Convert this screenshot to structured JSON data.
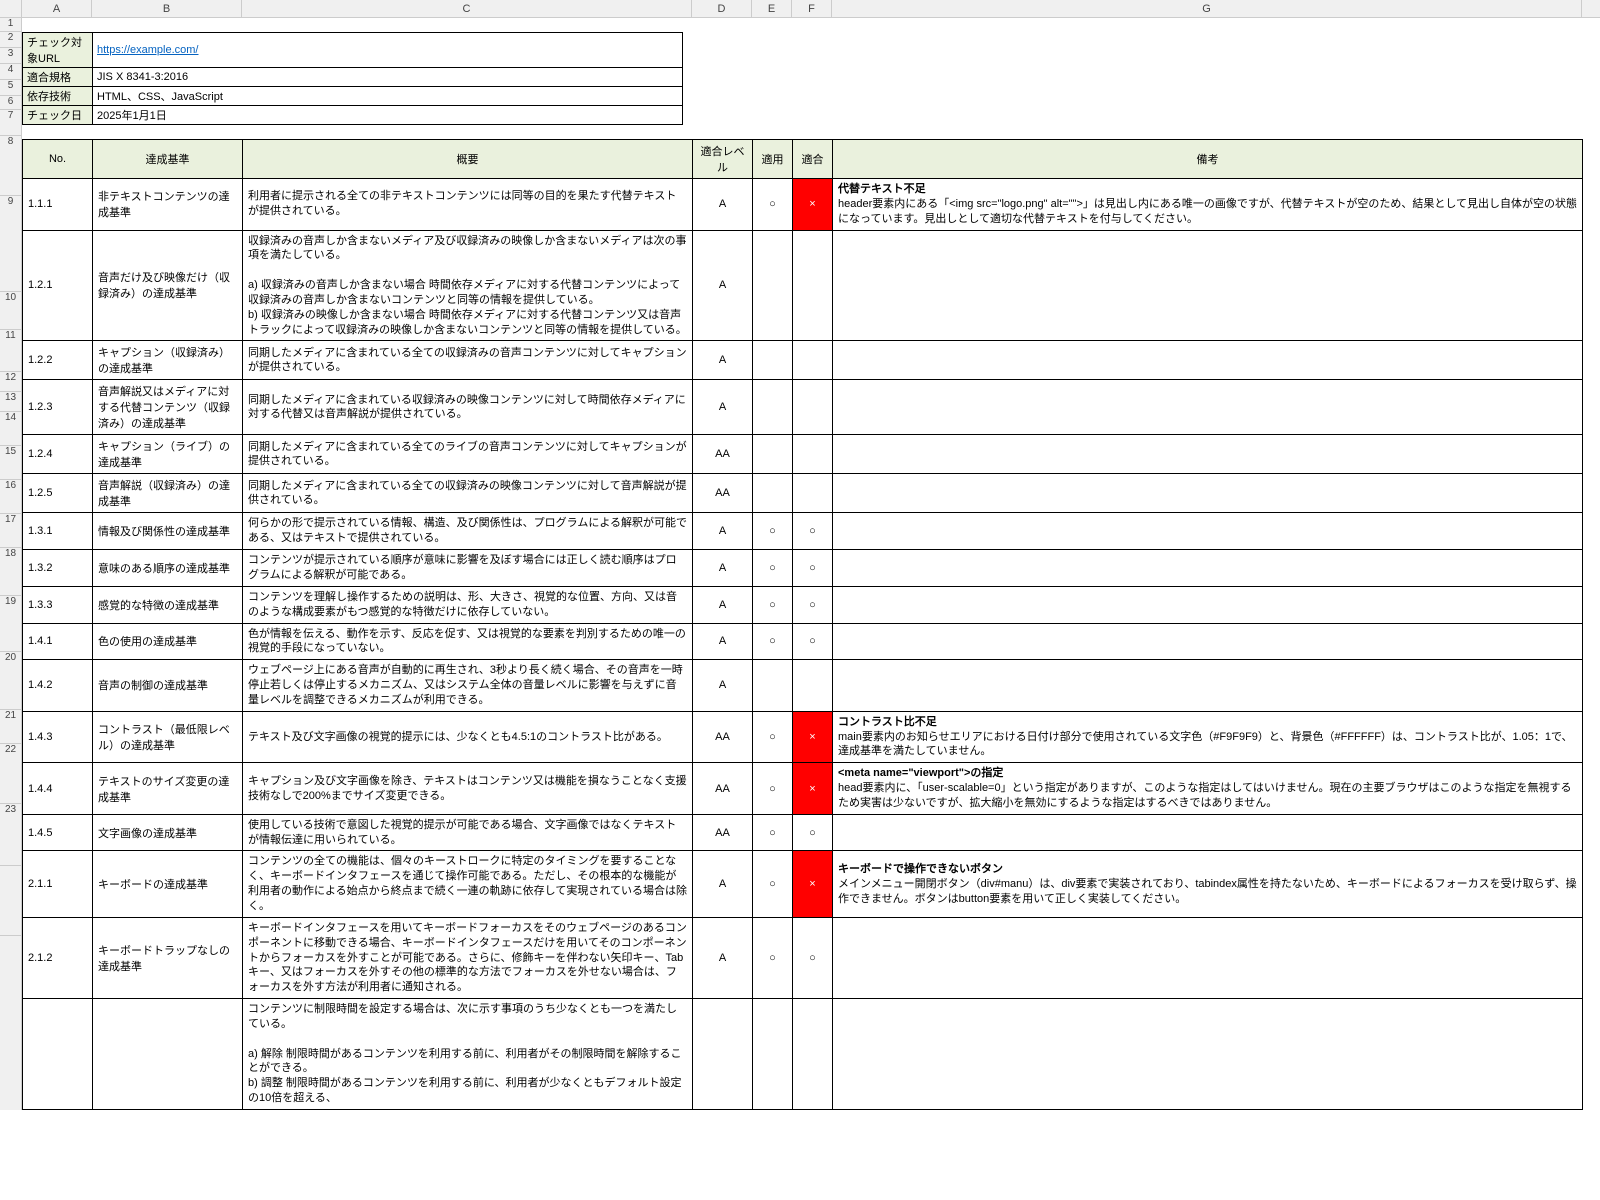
{
  "col_letters": [
    "A",
    "B",
    "C",
    "D",
    "E",
    "F",
    "G"
  ],
  "meta": {
    "url_label": "チェック対象URL",
    "url_value": "https://example.com/",
    "std_label": "適合規格",
    "std_value": "JIS X 8341-3:2016",
    "tech_label": "依存技術",
    "tech_value": "HTML、CSS、JavaScript",
    "date_label": "チェック日",
    "date_value": "2025年1月1日"
  },
  "headers": {
    "no": "No.",
    "criterion": "達成基準",
    "summary": "概要",
    "level": "適合レベル",
    "applicable": "適用",
    "conform": "適合",
    "note": "備考"
  },
  "rows": [
    {
      "no": "1.1.1",
      "criterion": "非テキストコンテンツの達成基準",
      "summary": "利用者に提示される全ての非テキストコンテンツには同等の目的を果たす代替テキストが提供されている。",
      "level": "A",
      "applicable": "○",
      "conform": "×",
      "fail": true,
      "note_title": "代替テキスト不足",
      "note_body": "header要素内にある「<img src=\"logo.png\" alt=\"\">」は見出し内にある唯一の画像ですが、代替テキストが空のため、結果として見出し自体が空の状態になっています。見出しとして適切な代替テキストを付与してください。"
    },
    {
      "no": "1.2.1",
      "criterion": "音声だけ及び映像だけ（収録済み）の達成基準",
      "summary": "収録済みの音声しか含まないメディア及び収録済みの映像しか含まないメディアは次の事項を満たしている。\n\na) 収録済みの音声しか含まない場合 時間依存メディアに対する代替コンテンツによって収録済みの音声しか含まないコンテンツと同等の情報を提供している。\nb) 収録済みの映像しか含まない場合 時間依存メディアに対する代替コンテンツ又は音声トラックによって収録済みの映像しか含まないコンテンツと同等の情報を提供している。",
      "level": "A",
      "applicable": "",
      "conform": "",
      "fail": false,
      "note_title": "",
      "note_body": ""
    },
    {
      "no": "1.2.2",
      "criterion": "キャプション（収録済み）の達成基準",
      "summary": "同期したメディアに含まれている全ての収録済みの音声コンテンツに対してキャプションが提供されている。",
      "level": "A",
      "applicable": "",
      "conform": "",
      "fail": false,
      "note_title": "",
      "note_body": ""
    },
    {
      "no": "1.2.3",
      "criterion": "音声解説又はメディアに対する代替コンテンツ（収録済み）の達成基準",
      "summary": "同期したメディアに含まれている収録済みの映像コンテンツに対して時間依存メディアに対する代替又は音声解説が提供されている。",
      "level": "A",
      "applicable": "",
      "conform": "",
      "fail": false,
      "note_title": "",
      "note_body": ""
    },
    {
      "no": "1.2.4",
      "criterion": "キャプション（ライブ）の達成基準",
      "summary": "同期したメディアに含まれている全てのライブの音声コンテンツに対してキャプションが提供されている。",
      "level": "AA",
      "applicable": "",
      "conform": "",
      "fail": false,
      "note_title": "",
      "note_body": ""
    },
    {
      "no": "1.2.5",
      "criterion": "音声解説（収録済み）の達成基準",
      "summary": "同期したメディアに含まれている全ての収録済みの映像コンテンツに対して音声解説が提供されている。",
      "level": "AA",
      "applicable": "",
      "conform": "",
      "fail": false,
      "note_title": "",
      "note_body": ""
    },
    {
      "no": "1.3.1",
      "criterion": "情報及び関係性の達成基準",
      "summary": "何らかの形で提示されている情報、構造、及び関係性は、プログラムによる解釈が可能である、又はテキストで提供されている。",
      "level": "A",
      "applicable": "○",
      "conform": "○",
      "fail": false,
      "note_title": "",
      "note_body": ""
    },
    {
      "no": "1.3.2",
      "criterion": "意味のある順序の達成基準",
      "summary": "コンテンツが提示されている順序が意味に影響を及ぼす場合には正しく読む順序はプログラムによる解釈が可能である。",
      "level": "A",
      "applicable": "○",
      "conform": "○",
      "fail": false,
      "note_title": "",
      "note_body": ""
    },
    {
      "no": "1.3.3",
      "criterion": "感覚的な特徴の達成基準",
      "summary": "コンテンツを理解し操作するための説明は、形、大きさ、視覚的な位置、方向、又は音のような構成要素がもつ感覚的な特徴だけに依存していない。",
      "level": "A",
      "applicable": "○",
      "conform": "○",
      "fail": false,
      "note_title": "",
      "note_body": ""
    },
    {
      "no": "1.4.1",
      "criterion": "色の使用の達成基準",
      "summary": "色が情報を伝える、動作を示す、反応を促す、又は視覚的な要素を判別するための唯一の視覚的手段になっていない。",
      "level": "A",
      "applicable": "○",
      "conform": "○",
      "fail": false,
      "note_title": "",
      "note_body": ""
    },
    {
      "no": "1.4.2",
      "criterion": "音声の制御の達成基準",
      "summary": "ウェブページ上にある音声が自動的に再生され、3秒より長く続く場合、その音声を一時停止若しくは停止するメカニズム、又はシステム全体の音量レベルに影響を与えずに音量レベルを調整できるメカニズムが利用できる。",
      "level": "A",
      "applicable": "",
      "conform": "",
      "fail": false,
      "note_title": "",
      "note_body": ""
    },
    {
      "no": "1.4.3",
      "criterion": "コントラスト（最低限レベル）の達成基準",
      "summary": "テキスト及び文字画像の視覚的提示には、少なくとも4.5:1のコントラスト比がある。",
      "level": "AA",
      "applicable": "○",
      "conform": "×",
      "fail": true,
      "note_title": "コントラスト比不足",
      "note_body": "main要素内のお知らせエリアにおける日付け部分で使用されている文字色（#F9F9F9）と、背景色（#FFFFFF）は、コントラスト比が、1.05：1で、達成基準を満たしていません。"
    },
    {
      "no": "1.4.4",
      "criterion": "テキストのサイズ変更の達成基準",
      "summary": "キャプション及び文字画像を除き、テキストはコンテンツ又は機能を損なうことなく支援技術なしで200%までサイズ変更できる。",
      "level": "AA",
      "applicable": "○",
      "conform": "×",
      "fail": true,
      "note_title": "<meta name=\"viewport\">の指定",
      "note_body": "head要素内に、「user-scalable=0」という指定がありますが、このような指定はしてはいけません。現在の主要ブラウザはこのような指定を無視するため実害は少ないですが、拡大縮小を無効にするような指定はするべきではありません。"
    },
    {
      "no": "1.4.5",
      "criterion": "文字画像の達成基準",
      "summary": "使用している技術で意図した視覚的提示が可能である場合、文字画像ではなくテキストが情報伝達に用いられている。",
      "level": "AA",
      "applicable": "○",
      "conform": "○",
      "fail": false,
      "note_title": "",
      "note_body": ""
    },
    {
      "no": "2.1.1",
      "criterion": "キーボードの達成基準",
      "summary": "コンテンツの全ての機能は、個々のキーストロークに特定のタイミングを要することなく、キーボードインタフェースを通じて操作可能である。ただし、その根本的な機能が利用者の動作による始点から終点まで続く一連の軌跡に依存して実現されている場合は除く。",
      "level": "A",
      "applicable": "○",
      "conform": "×",
      "fail": true,
      "note_title": "キーボードで操作できないボタン",
      "note_body": "メインメニュー開閉ボタン（div#manu）は、div要素で実装されており、tabindex属性を持たないため、キーボードによるフォーカスを受け取らず、操作できません。ボタンはbutton要素を用いて正しく実装してください。"
    },
    {
      "no": "2.1.2",
      "criterion": "キーボードトラップなしの達成基準",
      "summary": "キーボードインタフェースを用いてキーボードフォーカスをそのウェブページのあるコンポーネントに移動できる場合、キーボードインタフェースだけを用いてそのコンポーネントからフォーカスを外すことが可能である。さらに、修飾キーを伴わない矢印キー、Tabキー、又はフォーカスを外すその他の標準的な方法でフォーカスを外せない場合は、フォーカスを外す方法が利用者に通知される。",
      "level": "A",
      "applicable": "○",
      "conform": "○",
      "fail": false,
      "note_title": "",
      "note_body": ""
    },
    {
      "no": "",
      "criterion": "",
      "summary": "コンテンツに制限時間を設定する場合は、次に示す事項のうち少なくとも一つを満たしている。\n\na) 解除 制限時間があるコンテンツを利用する前に、利用者がその制限時間を解除することができる。\nb) 調整 制限時間があるコンテンツを利用する前に、利用者が少なくともデフォルト設定の10倍を超える、",
      "level": "",
      "applicable": "",
      "conform": "",
      "fail": false,
      "note_title": "",
      "note_body": ""
    }
  ]
}
